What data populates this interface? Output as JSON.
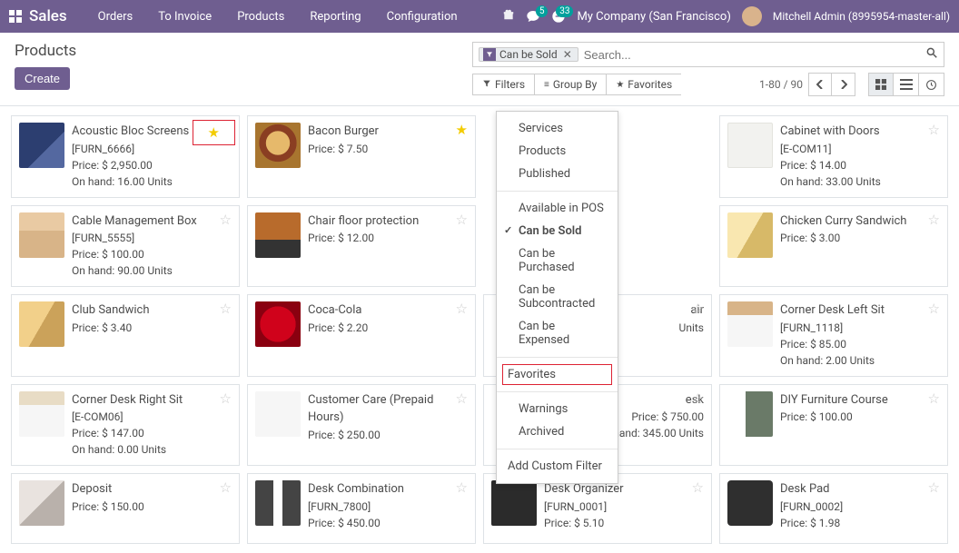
{
  "nav": {
    "brand": "Sales",
    "menu": [
      "Orders",
      "To Invoice",
      "Products",
      "Reporting",
      "Configuration"
    ],
    "chat_badge": "5",
    "activity_badge": "33",
    "company": "My Company (San Francisco)",
    "user": "Mitchell Admin (8995954-master-all)"
  },
  "header": {
    "title": "Products",
    "create": "Create"
  },
  "search": {
    "chip_label": "Can be Sold",
    "placeholder": "Search..."
  },
  "toolbar": {
    "filters": "Filters",
    "groupby": "Group By",
    "favorites": "Favorites",
    "pager": "1-80 / 90"
  },
  "filters_dropdown": {
    "group1": [
      "Services",
      "Products",
      "Published"
    ],
    "group2": [
      {
        "label": "Available in POS",
        "checked": false
      },
      {
        "label": "Can be Sold",
        "checked": true
      },
      {
        "label": "Can be Purchased",
        "checked": false
      },
      {
        "label": "Can be Subcontracted",
        "checked": false
      },
      {
        "label": "Can be Expensed",
        "checked": false
      }
    ],
    "favorites": "Favorites",
    "group3": [
      "Warnings",
      "Archived"
    ],
    "add_custom": "Add Custom Filter"
  },
  "products": [
    {
      "name": "Acoustic Bloc Screens",
      "code": "[FURN_6666]",
      "price": "Price: $ 2,950.00",
      "onhand": "On hand: 16.00 Units",
      "img": "img-blue",
      "fav": true,
      "favbox": true
    },
    {
      "name": "Bacon Burger",
      "code": "",
      "price": "Price: $ 7.50",
      "onhand": "",
      "img": "img-burger",
      "fav": true
    },
    {
      "name": "",
      "code": "",
      "price": "",
      "onhand": "",
      "img": "",
      "hidden": true
    },
    {
      "name": "Cabinet with Doors",
      "code": "[E-COM11]",
      "price": "Price: $ 14.00",
      "onhand": "On hand: 33.00 Units",
      "img": "img-cabinet"
    },
    {
      "name": "Cable Management Box",
      "code": "[FURN_5555]",
      "price": "Price: $ 100.00",
      "onhand": "On hand: 90.00 Units",
      "img": "img-cable"
    },
    {
      "name": "Chair floor protection",
      "code": "",
      "price": "Price: $ 12.00",
      "onhand": "",
      "img": "img-chair"
    },
    {
      "name": "",
      "code": "",
      "price": "",
      "onhand": "",
      "img": "",
      "hidden": true
    },
    {
      "name": "Chicken Curry Sandwich",
      "code": "",
      "price": "Price: $ 3.00",
      "onhand": "",
      "img": "img-chicken"
    },
    {
      "name": "Club Sandwich",
      "code": "",
      "price": "Price: $ 3.40",
      "onhand": "",
      "img": "img-club"
    },
    {
      "name": "Coca-Cola",
      "code": "",
      "price": "Price: $ 2.20",
      "onhand": "",
      "img": "img-coke"
    },
    {
      "name": "air",
      "code": "",
      "price": "",
      "onhand": "Units",
      "img": "",
      "partial": true
    },
    {
      "name": "Corner Desk Left Sit",
      "code": "[FURN_1118]",
      "price": "Price: $ 85.00",
      "onhand": "On hand: 2.00 Units",
      "img": "img-desk1"
    },
    {
      "name": "Corner Desk Right Sit",
      "code": "[E-COM06]",
      "price": "Price: $ 147.00",
      "onhand": "On hand: 0.00 Units",
      "img": "img-desk2"
    },
    {
      "name": "Customer Care (Prepaid Hours)",
      "code": "",
      "price": "Price: $ 250.00",
      "onhand": "",
      "img": "img-white"
    },
    {
      "name": "esk",
      "code": "",
      "price": "Price: $ 750.00",
      "onhand": "On hand: 345.00 Units",
      "img": "",
      "partial": true
    },
    {
      "name": "DIY Furniture Course",
      "code": "",
      "price": "Price: $ 100.00",
      "onhand": "",
      "img": "img-diy"
    },
    {
      "name": "Deposit",
      "code": "",
      "price": "Price: $ 150.00",
      "onhand": "",
      "img": "img-hand"
    },
    {
      "name": "Desk Combination",
      "code": "[FURN_7800]",
      "price": "Price: $ 450.00",
      "onhand": "",
      "img": "img-combo"
    },
    {
      "name": "Desk Organizer",
      "code": "[FURN_0001]",
      "price": "Price: $ 5.10",
      "onhand": "",
      "img": "img-organizer"
    },
    {
      "name": "Desk Pad",
      "code": "[FURN_0002]",
      "price": "Price: $ 1.98",
      "onhand": "",
      "img": "img-deskpad"
    }
  ]
}
